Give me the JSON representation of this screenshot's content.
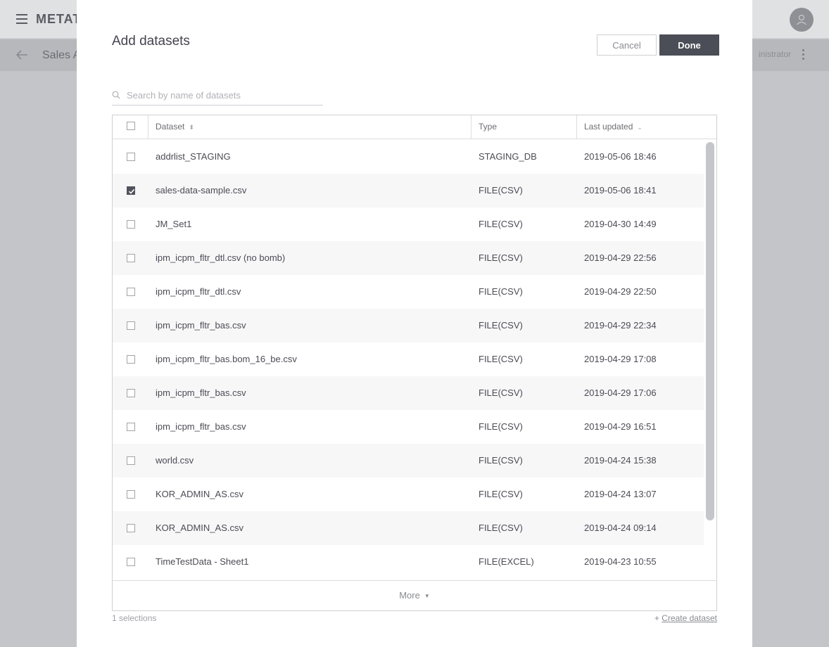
{
  "app": {
    "logo": "METAT",
    "subtitle": "Sales A",
    "role": "inistrator"
  },
  "modal": {
    "title": "Add datasets",
    "cancel_label": "Cancel",
    "done_label": "Done",
    "search_placeholder": "Search by name of datasets",
    "columns": {
      "dataset": "Dataset",
      "type": "Type",
      "last_updated": "Last updated"
    },
    "rows": [
      {
        "name": "addrlist_STAGING",
        "type": "STAGING_DB",
        "updated": "2019-05-06 18:46",
        "checked": false
      },
      {
        "name": "sales-data-sample.csv",
        "type": "FILE(CSV)",
        "updated": "2019-05-06 18:41",
        "checked": true
      },
      {
        "name": "JM_Set1",
        "type": "FILE(CSV)",
        "updated": "2019-04-30 14:49",
        "checked": false
      },
      {
        "name": "ipm_icpm_fltr_dtl.csv (no bomb)",
        "type": "FILE(CSV)",
        "updated": "2019-04-29 22:56",
        "checked": false
      },
      {
        "name": "ipm_icpm_fltr_dtl.csv",
        "type": "FILE(CSV)",
        "updated": "2019-04-29 22:50",
        "checked": false
      },
      {
        "name": "ipm_icpm_fltr_bas.csv",
        "type": "FILE(CSV)",
        "updated": "2019-04-29 22:34",
        "checked": false
      },
      {
        "name": "ipm_icpm_fltr_bas.bom_16_be.csv",
        "type": "FILE(CSV)",
        "updated": "2019-04-29 17:08",
        "checked": false
      },
      {
        "name": "ipm_icpm_fltr_bas.csv",
        "type": "FILE(CSV)",
        "updated": "2019-04-29 17:06",
        "checked": false
      },
      {
        "name": "ipm_icpm_fltr_bas.csv",
        "type": "FILE(CSV)",
        "updated": "2019-04-29 16:51",
        "checked": false
      },
      {
        "name": "world.csv",
        "type": "FILE(CSV)",
        "updated": "2019-04-24 15:38",
        "checked": false
      },
      {
        "name": "KOR_ADMIN_AS.csv",
        "type": "FILE(CSV)",
        "updated": "2019-04-24 13:07",
        "checked": false
      },
      {
        "name": "KOR_ADMIN_AS.csv",
        "type": "FILE(CSV)",
        "updated": "2019-04-24 09:14",
        "checked": false
      },
      {
        "name": "TimeTestData - Sheet1",
        "type": "FILE(EXCEL)",
        "updated": "2019-04-23 10:55",
        "checked": false
      }
    ],
    "more_label": "More",
    "selections_label": "1 selections",
    "create_prefix": "+",
    "create_label": "Create dataset"
  }
}
